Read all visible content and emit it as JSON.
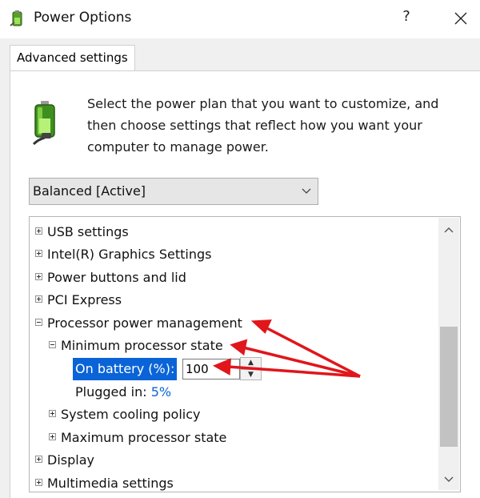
{
  "window": {
    "title": "Power Options",
    "help_label": "?",
    "close_icon": "close-icon",
    "app_icon": "power-options-icon"
  },
  "tabs": [
    {
      "label": "Advanced settings",
      "selected": true
    }
  ],
  "instructions": "Select the power plan that you want to customize, and then choose settings that reflect how you want your computer to manage power.",
  "plan_select": {
    "value": "Balanced [Active]",
    "icon": "chevron-down-icon"
  },
  "tree": {
    "usb": "USB settings",
    "graphics": "Intel(R) Graphics Settings",
    "power_buttons": "Power buttons and lid",
    "pci": "PCI Express",
    "processor": "Processor power management",
    "min_state": "Minimum processor state",
    "on_battery_label": "On battery (%):",
    "on_battery_value": "100",
    "plugged_in_label": "Plugged in:",
    "plugged_in_value": "5%",
    "cooling": "System cooling policy",
    "max_state": "Maximum processor state",
    "display": "Display",
    "multimedia": "Multimedia settings"
  },
  "colors": {
    "selection": "#0a64d8",
    "value_link": "#0a64d8",
    "annotation_arrows": "#e0161b"
  }
}
